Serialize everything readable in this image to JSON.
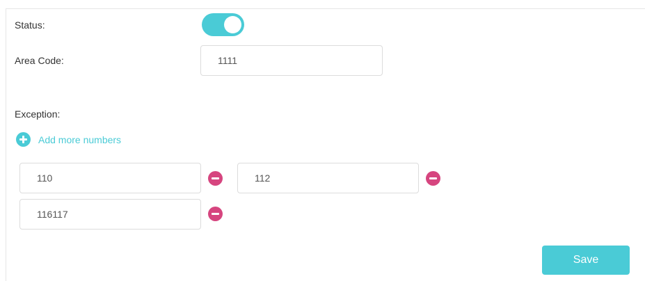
{
  "status": {
    "label": "Status:",
    "enabled": true
  },
  "area_code": {
    "label": "Area Code:",
    "value": "1111"
  },
  "exception": {
    "label": "Exception:",
    "add_label": "Add more numbers",
    "numbers": [
      "110",
      "112",
      "116117"
    ]
  },
  "actions": {
    "save_label": "Save"
  },
  "colors": {
    "accent": "#4acbd6",
    "remove": "#d6457f"
  }
}
